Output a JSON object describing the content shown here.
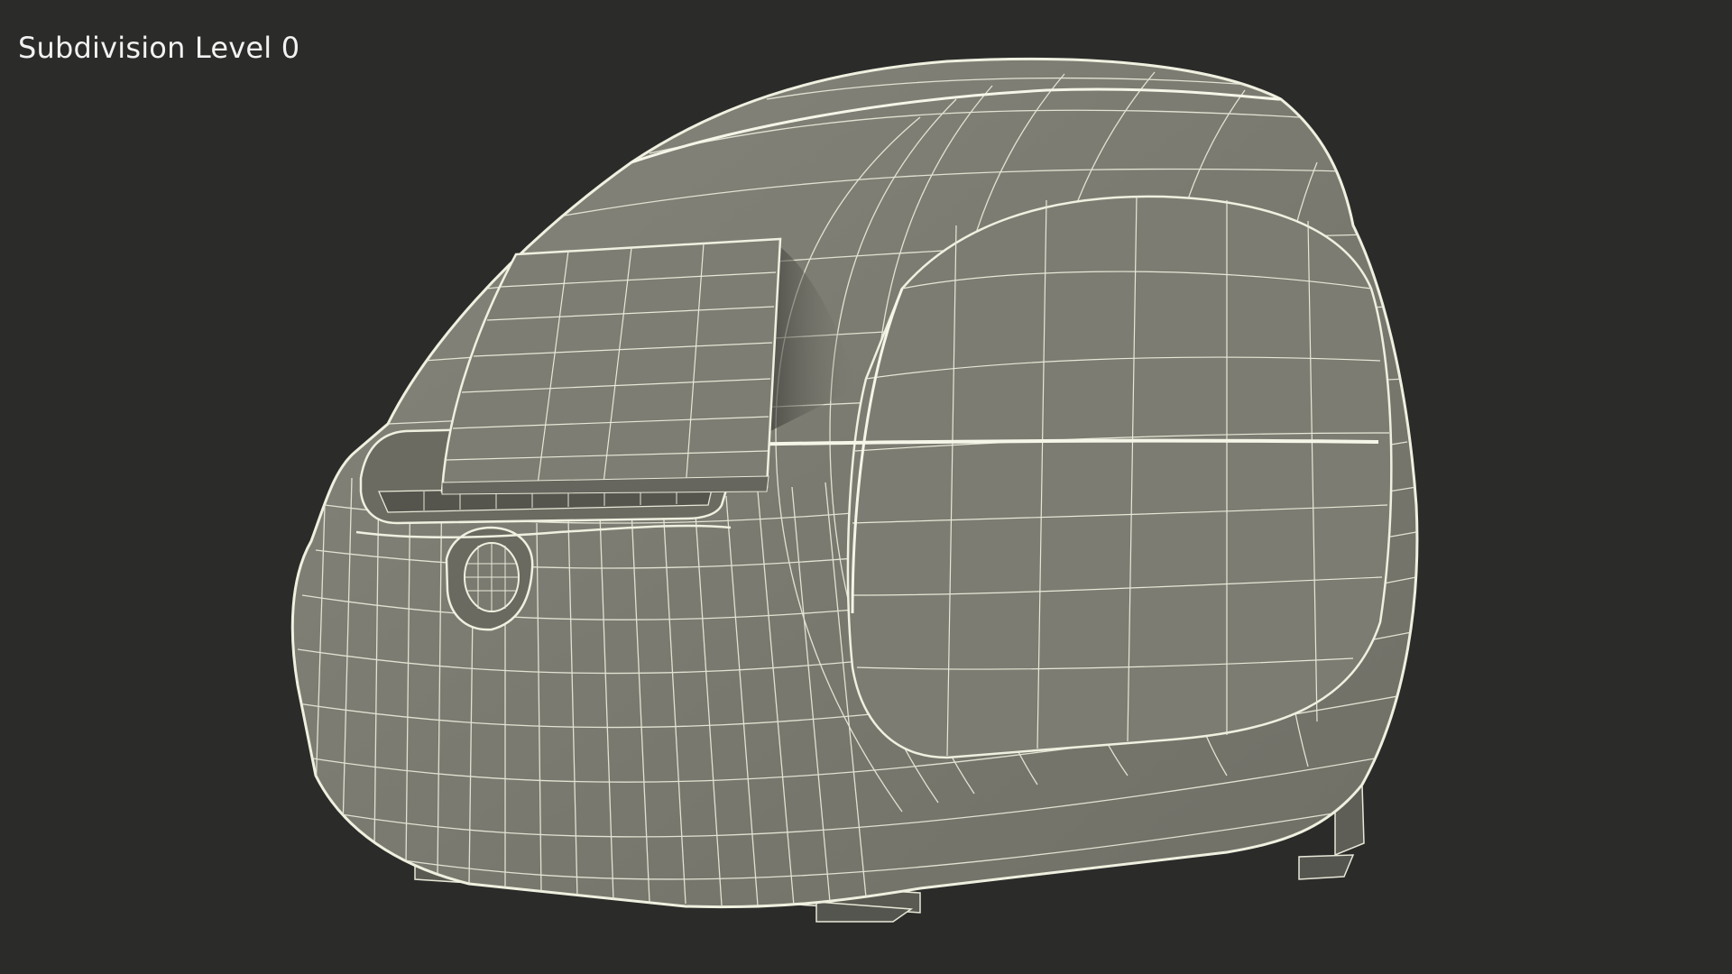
{
  "viewport": {
    "label": "Subdivision Level 0"
  },
  "render": {
    "background": "#2b2b2a",
    "surface": "#7a7a70",
    "surface_dark": "#5e5e56",
    "wire": "#e8e8d8",
    "subject": "label-printer-wireframe"
  }
}
